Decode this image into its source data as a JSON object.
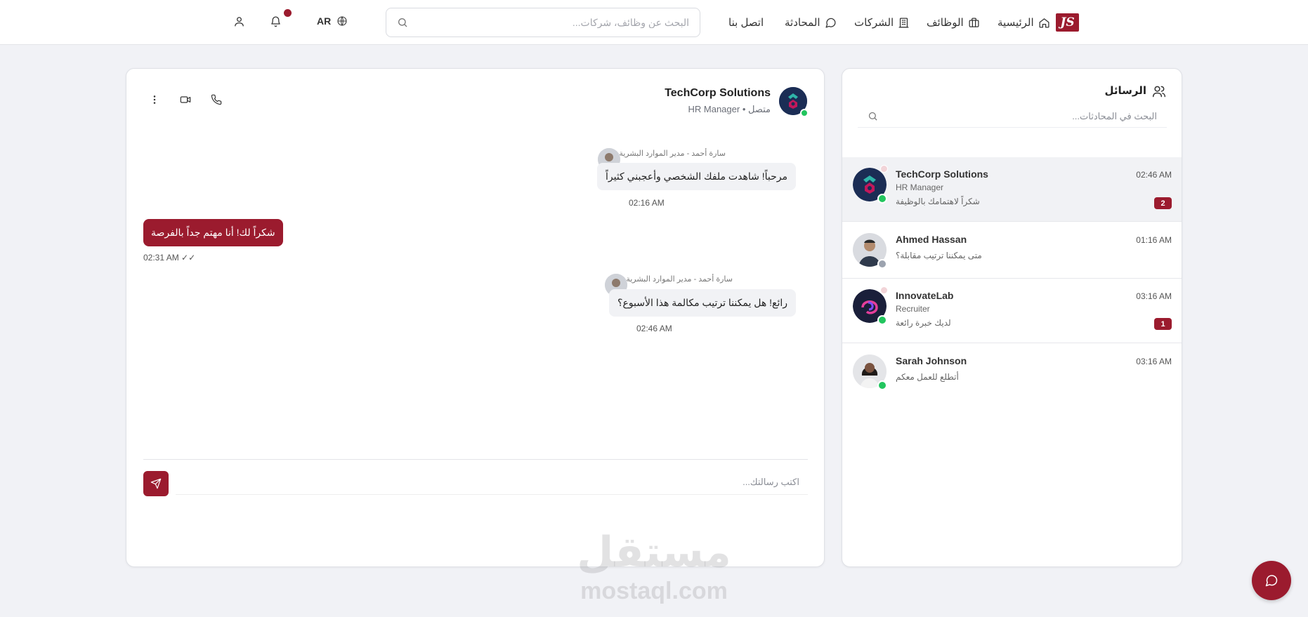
{
  "navbar": {
    "logo_text": "JS",
    "links": [
      {
        "label": "الرئيسية",
        "icon": "home-icon"
      },
      {
        "label": "الوظائف",
        "icon": "briefcase-icon"
      },
      {
        "label": "الشركات",
        "icon": "building-icon"
      },
      {
        "label": "المحادثة",
        "icon": "chat-bubble-icon"
      },
      {
        "label": "اتصل بنا",
        "icon": ""
      }
    ],
    "search_placeholder": "البحث عن وظائف، شركات...",
    "language": "AR",
    "notification_dot": true
  },
  "chat": {
    "name": "TechCorp Solutions",
    "status": "متصل",
    "role": "HR Manager",
    "online": true,
    "messages": [
      {
        "direction": "in",
        "sender": "سارة أحمد - مدير الموارد البشرية",
        "text": "مرحباً! شاهدت ملفك الشخصي وأعجبني كثيراً",
        "time": "02:16 AM"
      },
      {
        "direction": "out",
        "text": "شكراً لك! أنا مهتم جداً بالفرصة",
        "time": "02:31 AM",
        "read_mark": "✓✓"
      },
      {
        "direction": "in",
        "sender": "سارة أحمد - مدير الموارد البشرية",
        "text": "رائع! هل يمكننا ترتيب مكالمة هذا الأسبوع؟",
        "time": "02:46 AM"
      }
    ],
    "composer_placeholder": "اكتب رسالتك..."
  },
  "conversations": {
    "title": "الرسائل",
    "search_placeholder": "البحث في المحادثات...",
    "items": [
      {
        "name": "TechCorp Solutions",
        "role": "HR Manager",
        "last_message": "شكراً لاهتمامك بالوظيفة",
        "time": "02:46 AM",
        "unread": "2",
        "online": true,
        "active": true
      },
      {
        "name": "Ahmed Hassan",
        "role": "",
        "last_message": "متى يمكننا ترتيب مقابلة؟",
        "time": "01:16 AM",
        "unread": "",
        "online": false,
        "active": false
      },
      {
        "name": "InnovateLab",
        "role": "Recruiter",
        "last_message": "لديك خبرة رائعة",
        "time": "03:16 AM",
        "unread": "1",
        "online": true,
        "active": false
      },
      {
        "name": "Sarah Johnson",
        "role": "",
        "last_message": "أتطلع للعمل معكم",
        "time": "03:16 AM",
        "unread": "",
        "online": true,
        "active": false
      }
    ]
  },
  "watermark": {
    "arabic": "مستقل",
    "latin": "mostaql.com"
  },
  "colors": {
    "accent": "#9b1b2e",
    "online": "#22c55e",
    "offline": "#9ca3af",
    "background": "#f1f2f6"
  }
}
